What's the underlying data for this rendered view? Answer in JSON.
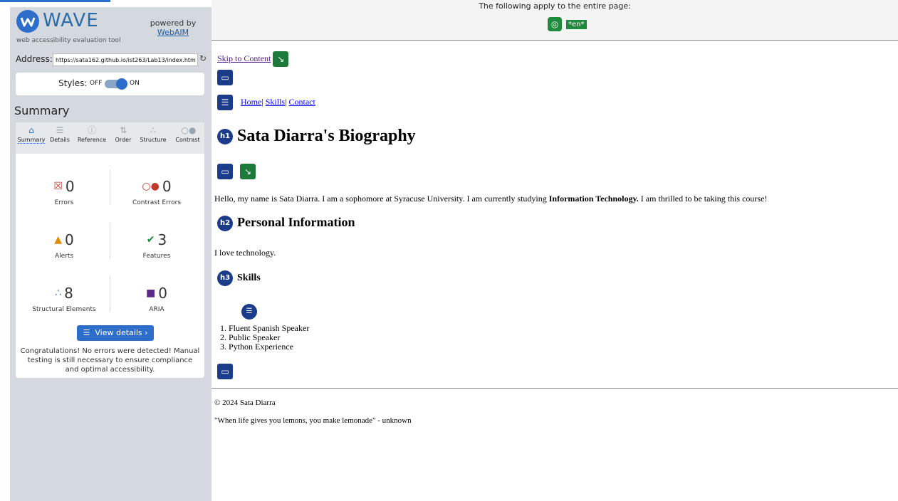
{
  "sidebar": {
    "brand": {
      "name": "WAVE",
      "tagline": "web accessibility evaluation tool",
      "powered_by": "powered by",
      "powered_link": "WebAIM"
    },
    "address": {
      "label": "Address:",
      "value": "https://sata162.github.io/ist263/Lab13/index.htm"
    },
    "styles": {
      "label": "Styles:",
      "off": "OFF",
      "on": "ON"
    },
    "summary_title": "Summary",
    "tabs": [
      {
        "label": "Summary",
        "icon": "home-icon"
      },
      {
        "label": "Details",
        "icon": "list-icon"
      },
      {
        "label": "Reference",
        "icon": "info-icon"
      },
      {
        "label": "Order",
        "icon": "order-icon"
      },
      {
        "label": "Structure",
        "icon": "structure-icon"
      },
      {
        "label": "Contrast",
        "icon": "contrast-icon"
      }
    ],
    "stats": {
      "errors": {
        "value": "0",
        "label": "Errors"
      },
      "contrast_errors": {
        "value": "0",
        "label": "Contrast Errors"
      },
      "alerts": {
        "value": "0",
        "label": "Alerts"
      },
      "features": {
        "value": "3",
        "label": "Features"
      },
      "structural": {
        "value": "8",
        "label": "Structural Elements"
      },
      "aria": {
        "value": "0",
        "label": "ARIA"
      }
    },
    "view_details": "View details ›",
    "congrats": "Congratulations! No errors were detected! Manual testing is still necessary to ensure compliance and optimal accessibility."
  },
  "page": {
    "banner_text": "The following apply to the entire page:",
    "lang_tag": "*en*",
    "skip_link": "Skip to Content",
    "nav": [
      "Home",
      "Skills",
      "Contact"
    ],
    "h1_badge": "h1",
    "h1": "Sata Diarra's Biography",
    "bio_pre": "Hello, my name is Sata Diarra. I am a sophomore at Syracuse University. I am currently studying ",
    "bio_strong": "Information Technology.",
    "bio_post": " I am thrilled to be taking this course!",
    "h2_badge": "h2",
    "h2": "Personal Information",
    "love": "I love technology.",
    "h3_badge": "h3",
    "h3": "Skills",
    "skills": [
      "Fluent Spanish Speaker",
      "Public Speaker",
      "Python Experience"
    ],
    "copyright": "© 2024 Sata Diarra",
    "quote": "\"When life gives you lemons, you make lemonade\" - unknown"
  },
  "colors": {
    "accent": "#2c6ec9",
    "error": "#c0392b",
    "alert": "#e08a00",
    "feature": "#1e8a3c",
    "aria": "#5b2a86",
    "structure": "#1a3c8a"
  }
}
